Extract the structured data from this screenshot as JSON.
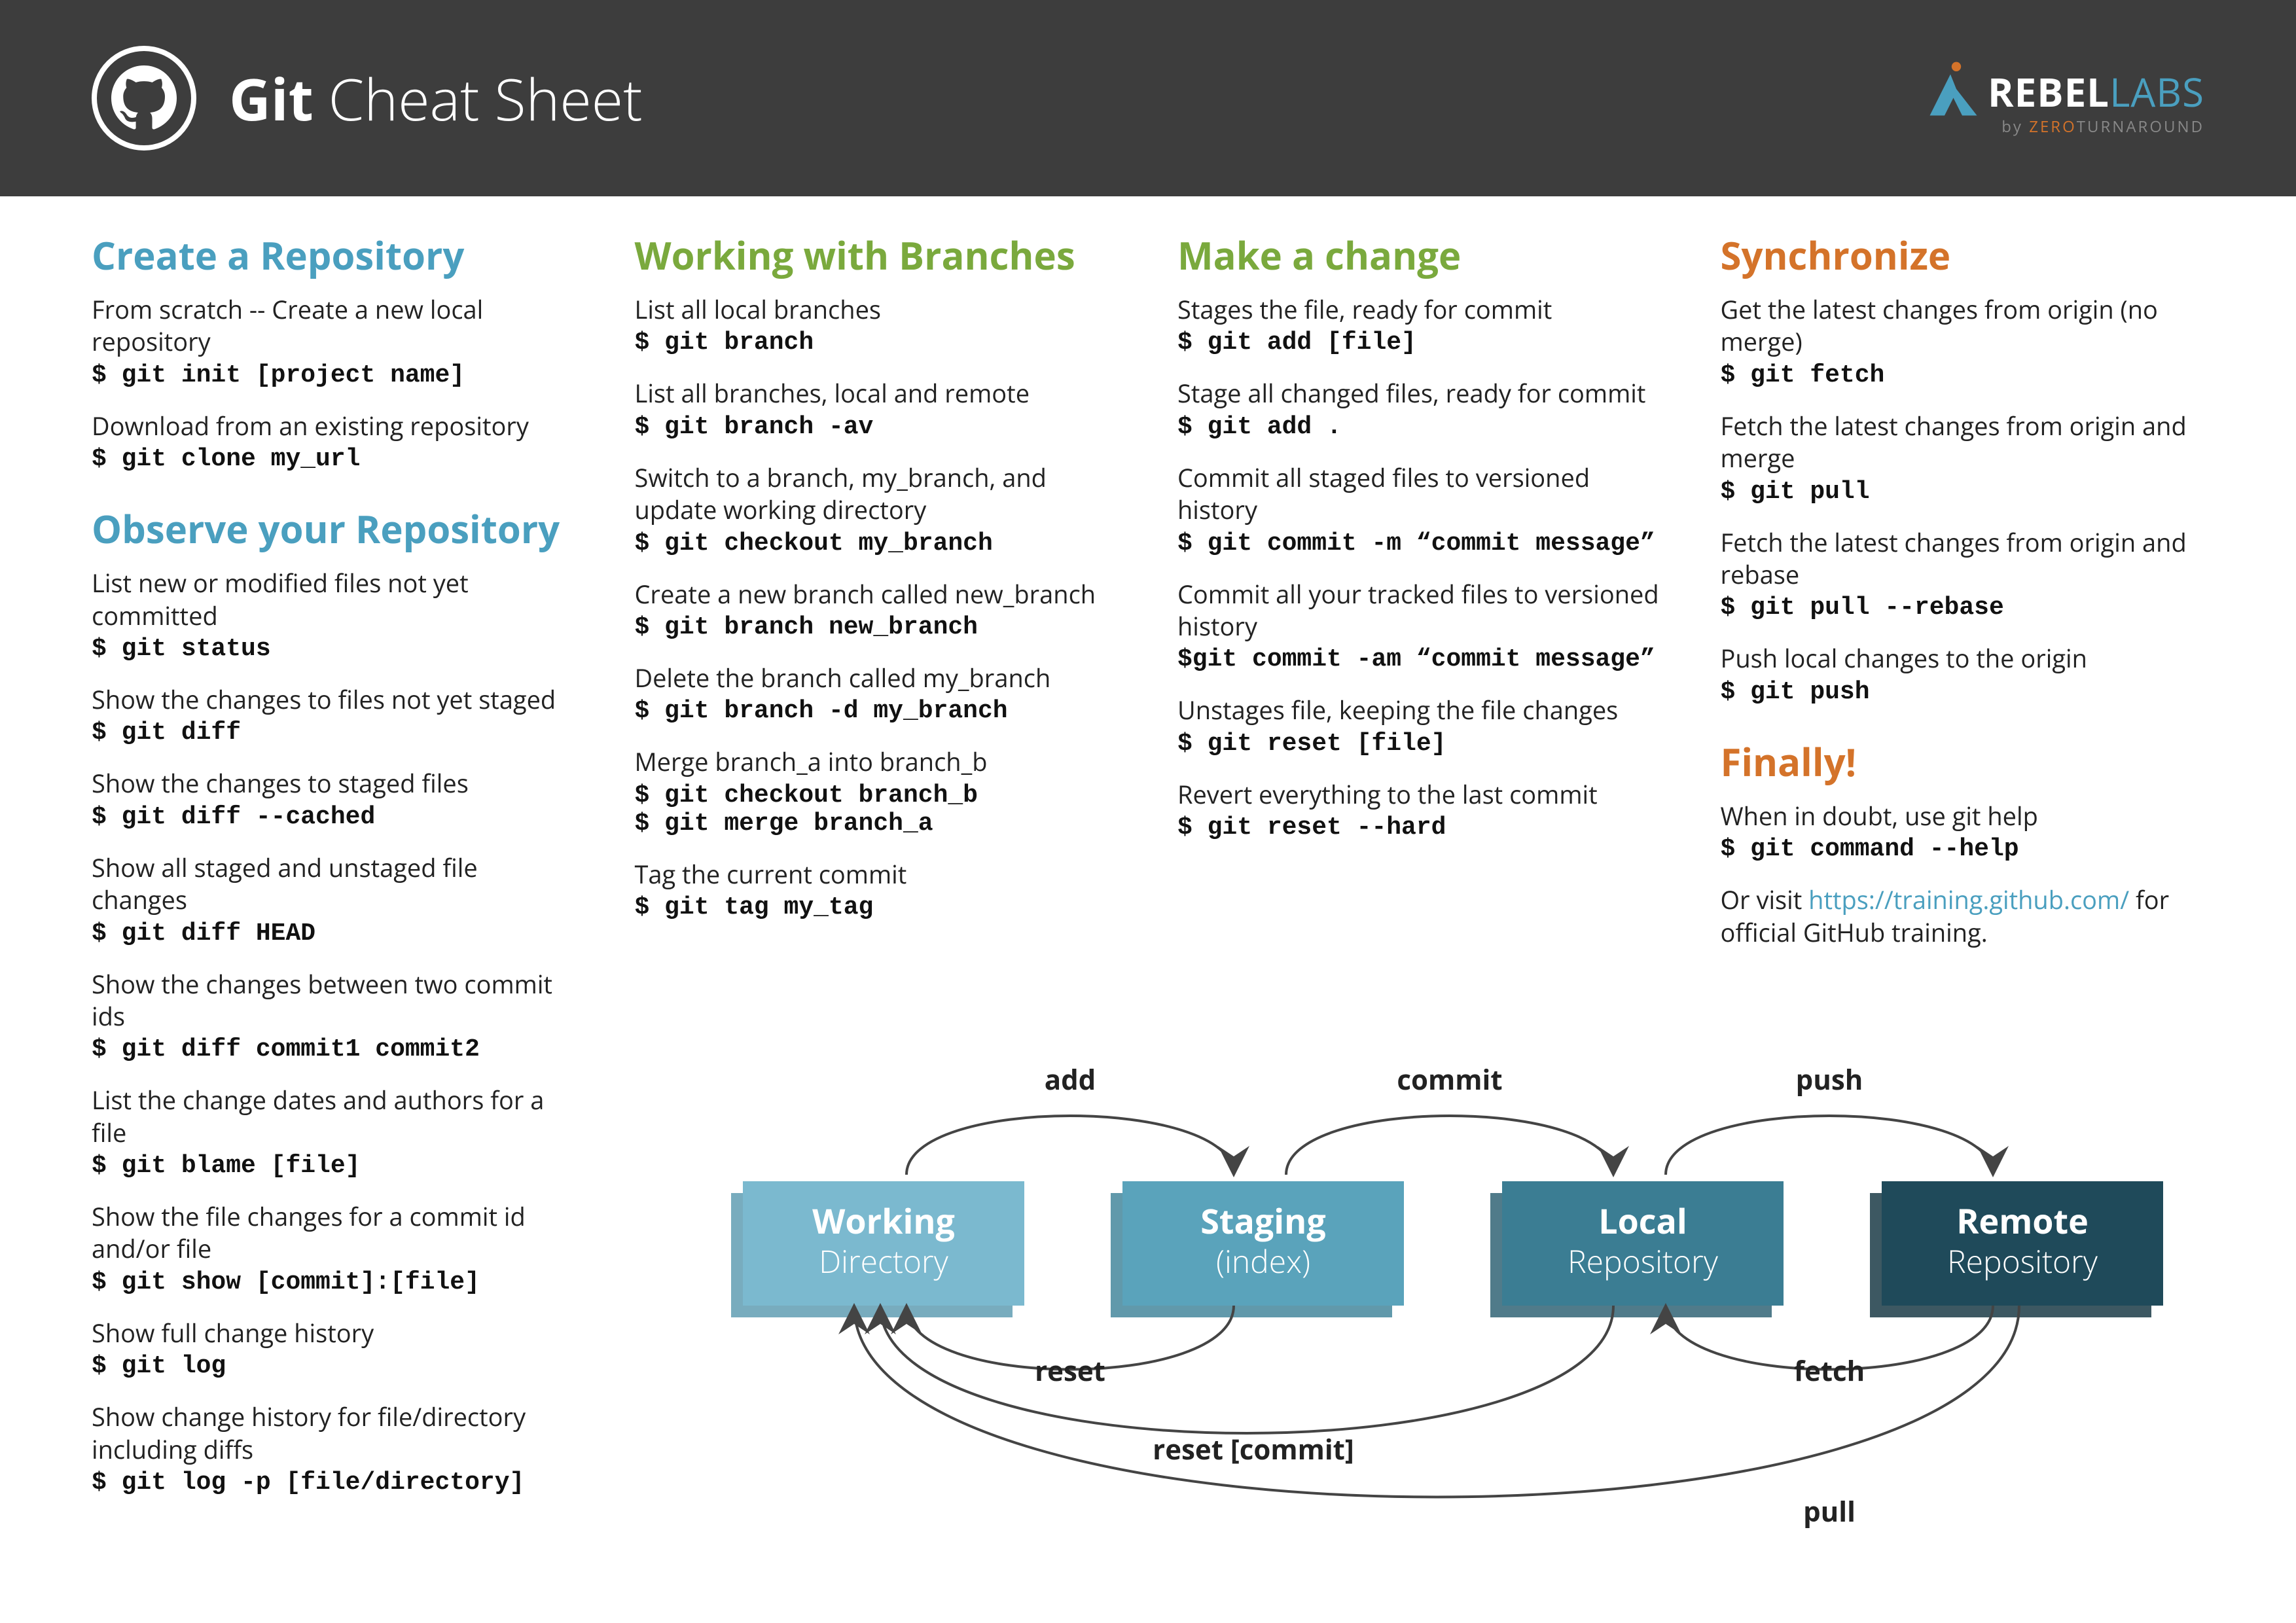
{
  "header": {
    "title_bold": "Git",
    "title_light": " Cheat Sheet",
    "logo_main1": "REBEL",
    "logo_main2": "LABS",
    "logo_sub_pre": "by ",
    "logo_sub_orange": "ZERO",
    "logo_sub_post": "TURNAROUND"
  },
  "col1": {
    "s1_title": "Create a Repository",
    "s1": [
      {
        "d": "From scratch -- Create a new local repository",
        "c": "$ git init [project name]"
      },
      {
        "d": "Download from an existing repository",
        "c": "$ git clone my_url"
      }
    ],
    "s2_title": "Observe your Repository",
    "s2": [
      {
        "d": "List new or modified files not yet committed",
        "c": "$ git status"
      },
      {
        "d": "Show the changes to files not yet staged",
        "c": "$ git diff"
      },
      {
        "d": "Show the changes to staged files",
        "c": "$ git diff --cached"
      },
      {
        "d": "Show all staged and unstaged file changes",
        "c": "$ git diff HEAD"
      },
      {
        "d": "Show the changes between two commit ids",
        "c": "$ git diff commit1 commit2"
      },
      {
        "d": "List the change dates and authors for a file",
        "c": "$ git blame [file]"
      },
      {
        "d": "Show the file changes for a commit id and/or file",
        "c": "$ git show [commit]:[file]"
      },
      {
        "d": "Show full change history",
        "c": "$ git log"
      },
      {
        "d": "Show change history for file/directory including diffs",
        "c": "$ git log -p [file/directory]"
      }
    ]
  },
  "col2": {
    "s1_title": "Working with Branches",
    "s1": [
      {
        "d": "List all local branches",
        "c": "$ git branch"
      },
      {
        "d": "List all branches, local and remote",
        "c": "$ git branch -av"
      },
      {
        "d": "Switch to a branch, my_branch, and update working directory",
        "c": "$ git checkout my_branch"
      },
      {
        "d": "Create a new branch called new_branch",
        "c": "$ git branch new_branch"
      },
      {
        "d": "Delete the branch called my_branch",
        "c": "$ git branch -d my_branch"
      },
      {
        "d": "Merge branch_a into branch_b",
        "c": "$ git checkout branch_b\n$ git merge branch_a"
      },
      {
        "d": "Tag the current commit",
        "c": "$ git tag my_tag"
      }
    ]
  },
  "col3": {
    "s1_title": "Make a change",
    "s1": [
      {
        "d": "Stages the file, ready for commit",
        "c": "$ git add [file]"
      },
      {
        "d": "Stage all changed files, ready for commit",
        "c": "$ git add ."
      },
      {
        "d": "Commit all staged files to versioned history",
        "c": "$ git commit -m “commit message”"
      },
      {
        "d": "Commit all your tracked files to versioned history",
        "c": "$git commit -am “commit message”"
      },
      {
        "d": "Unstages file, keeping the file changes",
        "c": "$ git reset [file]"
      },
      {
        "d": "Revert everything to the last commit",
        "c": "$ git reset --hard"
      }
    ]
  },
  "col4": {
    "s1_title": "Synchronize",
    "s1": [
      {
        "d": "Get the latest changes from origin (no merge)",
        "c": "$ git fetch"
      },
      {
        "d": "Fetch the latest changes from origin and merge",
        "c": "$ git pull"
      },
      {
        "d": "Fetch the latest changes from origin and rebase",
        "c": "$ git pull --rebase"
      },
      {
        "d": "Push local changes to the origin",
        "c": "$ git push"
      }
    ],
    "s2_title": "Finally!",
    "s2_desc": "When in doubt, use git help",
    "s2_cmd": "$ git command --help",
    "s2_foot_pre": "Or visit ",
    "s2_foot_link": "https://training.github.com/",
    "s2_foot_post": " for official GitHub training."
  },
  "diagram": {
    "boxes": [
      {
        "t1": "Working",
        "t2": "Directory",
        "fill": "#7bb9cf",
        "shadow": "#5a9ab0"
      },
      {
        "t1": "Staging",
        "t2": "(index)",
        "fill": "#5aa3bb",
        "shadow": "#3e8299"
      },
      {
        "t1": "Local",
        "t2": "Repository",
        "fill": "#3b7d93",
        "shadow": "#2a5e70"
      },
      {
        "t1": "Remote",
        "t2": "Repository",
        "fill": "#1f4a5a",
        "shadow": "#123340"
      }
    ],
    "labels": {
      "add": "add",
      "commit": "commit",
      "push": "push",
      "reset": "reset",
      "fetch": "fetch",
      "reset_commit": "reset [commit]",
      "pull": "pull"
    }
  }
}
